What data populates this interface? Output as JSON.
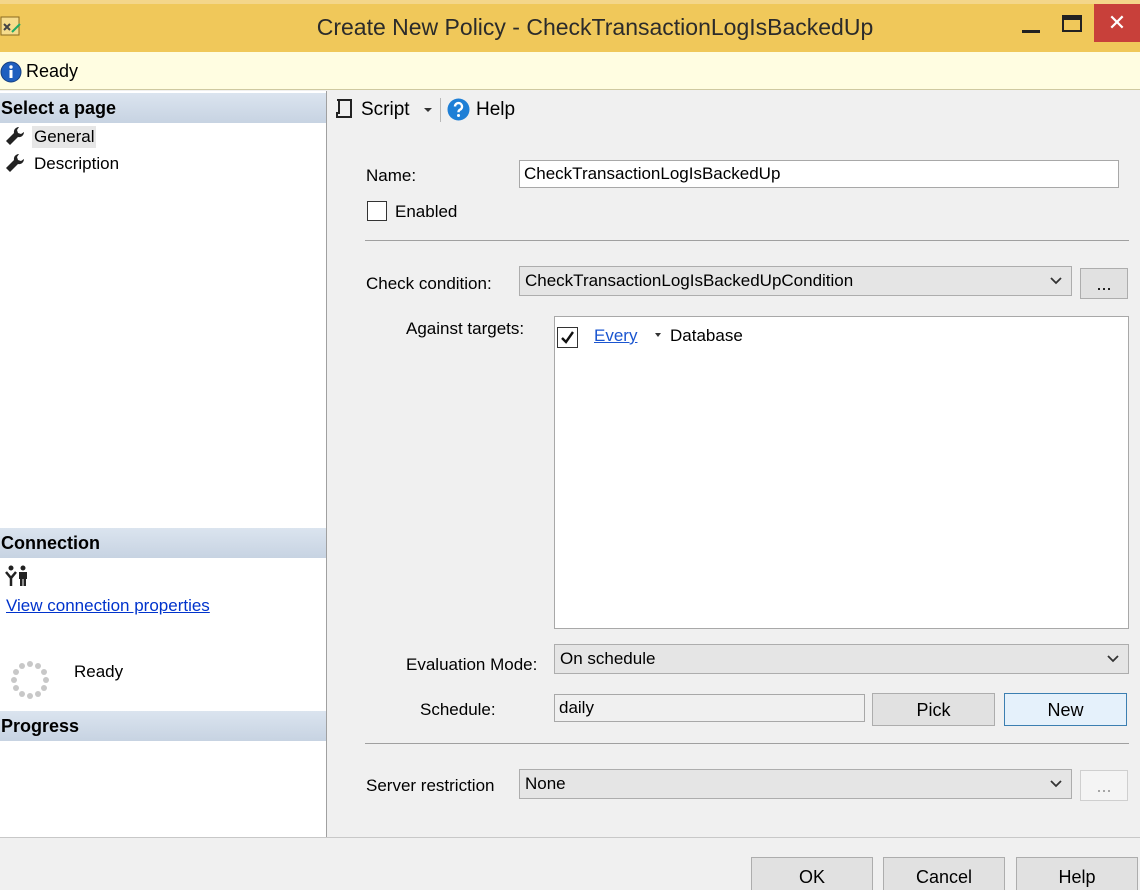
{
  "window": {
    "title": "Create New Policy - CheckTransactionLogIsBackedUp",
    "close_glyph": "✕"
  },
  "status": {
    "text": "Ready",
    "icon": "info-icon"
  },
  "left": {
    "select_page_header": "Select a page",
    "pages": [
      {
        "label": "General",
        "selected": true
      },
      {
        "label": "Description",
        "selected": false
      }
    ],
    "connection_header": "Connection",
    "view_connection_link": "View connection properties",
    "progress_header": "Progress",
    "progress_status": "Ready"
  },
  "toolbar": {
    "script_label": "Script",
    "help_label": "Help"
  },
  "form": {
    "name_label": "Name:",
    "name_value": "CheckTransactionLogIsBackedUp",
    "enabled_label": "Enabled",
    "enabled_checked": false,
    "check_condition_label": "Check condition:",
    "check_condition_value": "CheckTransactionLogIsBackedUpCondition",
    "ellipsis": "...",
    "against_targets_label": "Against targets:",
    "target_every": "Every",
    "target_database": "Database",
    "target_checked": true,
    "evaluation_mode_label": "Evaluation Mode:",
    "evaluation_mode_value": "On schedule",
    "schedule_label": "Schedule:",
    "schedule_value": "daily",
    "pick_label": "Pick",
    "new_label": "New",
    "server_restriction_label": "Server restriction",
    "server_restriction_value": "None",
    "server_restriction_ellipsis": "..."
  },
  "buttons": {
    "ok": "OK",
    "cancel": "Cancel",
    "help": "Help"
  },
  "colors": {
    "titlebar": "#f0c85a",
    "close": "#c8403a",
    "status_bg": "#fffde1",
    "link": "#0033cc"
  }
}
